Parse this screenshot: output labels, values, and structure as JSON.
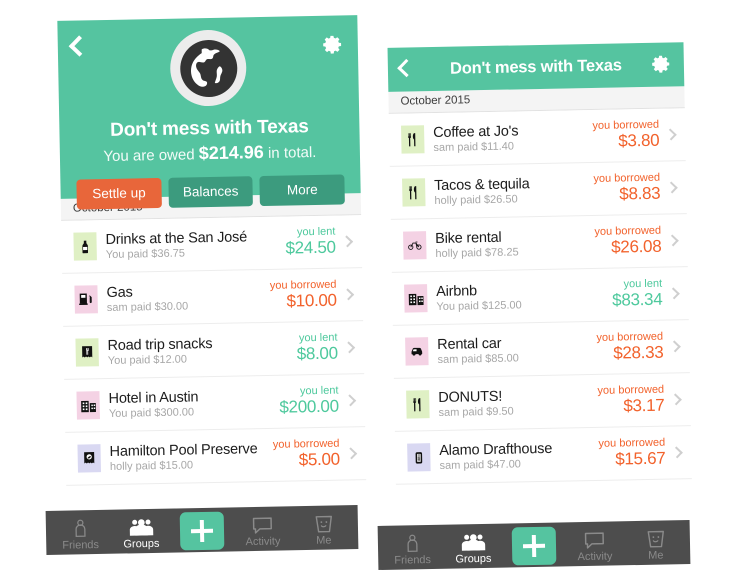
{
  "app": {
    "accent_teal": "#55c4a0",
    "accent_orange": "#e8663a",
    "lent_color": "#4ec99d",
    "borrowed_color": "#f2622c",
    "tabbar_color": "#4d4d4d"
  },
  "left_panel": {
    "back_icon": "back-chevron-icon",
    "settings_icon": "gear-icon",
    "avatar_icon": "globe-avatar",
    "group_title": "Don't mess with Texas",
    "balance_prefix": "You are owed",
    "balance_amount": "$214.96",
    "balance_suffix": "in total.",
    "buttons": [
      {
        "label": "Settle up",
        "style": "primary"
      },
      {
        "label": "Balances",
        "style": "secondary"
      },
      {
        "label": "More",
        "style": "secondary"
      }
    ],
    "month": "October 2015",
    "expenses": [
      {
        "title": "Drinks at the San José",
        "subtitle": "You paid $36.75",
        "label": "you lent",
        "amount": "$24.50",
        "type": "lent",
        "icon": "bottle-icon",
        "icon_bg": "green"
      },
      {
        "title": "Gas",
        "subtitle": "sam paid $30.00",
        "label": "you borrowed",
        "amount": "$10.00",
        "type": "borrowed",
        "icon": "gas-pump-icon",
        "icon_bg": "pink"
      },
      {
        "title": "Road trip snacks",
        "subtitle": "You paid $12.00",
        "label": "you lent",
        "amount": "$8.00",
        "type": "lent",
        "icon": "receipt-icon",
        "icon_bg": "green"
      },
      {
        "title": "Hotel in Austin",
        "subtitle": "You paid $300.00",
        "label": "you lent",
        "amount": "$200.00",
        "type": "lent",
        "icon": "building-icon",
        "icon_bg": "pink"
      },
      {
        "title": "Hamilton Pool Preserve",
        "subtitle": "holly paid $15.00",
        "label": "you borrowed",
        "amount": "$5.00",
        "type": "borrowed",
        "icon": "ticket-icon",
        "icon_bg": "purple"
      }
    ],
    "tabs": [
      {
        "label": "Friends",
        "icon": "person-icon",
        "active": false
      },
      {
        "label": "Groups",
        "icon": "group-icon",
        "active": true
      },
      {
        "label": "Activity",
        "icon": "speech-bubble-icon",
        "active": false
      },
      {
        "label": "Me",
        "icon": "smiley-cup-icon",
        "active": false
      }
    ],
    "add_button": "add-expense-button"
  },
  "right_panel": {
    "back_icon": "back-chevron-icon",
    "settings_icon": "gear-icon",
    "group_title": "Don't mess with Texas",
    "month": "October 2015",
    "expenses": [
      {
        "title": "Coffee at Jo's",
        "subtitle": "sam paid $11.40",
        "label": "you borrowed",
        "amount": "$3.80",
        "type": "borrowed",
        "icon": "cutlery-icon",
        "icon_bg": "green"
      },
      {
        "title": "Tacos & tequila",
        "subtitle": "holly paid $26.50",
        "label": "you borrowed",
        "amount": "$8.83",
        "type": "borrowed",
        "icon": "cutlery-icon",
        "icon_bg": "green"
      },
      {
        "title": "Bike rental",
        "subtitle": "holly paid $78.25",
        "label": "you borrowed",
        "amount": "$26.08",
        "type": "borrowed",
        "icon": "bicycle-icon",
        "icon_bg": "pink"
      },
      {
        "title": "Airbnb",
        "subtitle": "You paid $125.00",
        "label": "you lent",
        "amount": "$83.34",
        "type": "lent",
        "icon": "building-icon",
        "icon_bg": "pink"
      },
      {
        "title": "Rental car",
        "subtitle": "sam paid $85.00",
        "label": "you borrowed",
        "amount": "$28.33",
        "type": "borrowed",
        "icon": "car-icon",
        "icon_bg": "pink"
      },
      {
        "title": "DONUTS!",
        "subtitle": "sam paid $9.50",
        "label": "you borrowed",
        "amount": "$3.17",
        "type": "borrowed",
        "icon": "cutlery-icon",
        "icon_bg": "green"
      },
      {
        "title": "Alamo Drafthouse",
        "subtitle": "sam paid $47.00",
        "label": "you borrowed",
        "amount": "$15.67",
        "type": "borrowed",
        "icon": "film-icon",
        "icon_bg": "purple"
      }
    ],
    "tabs": [
      {
        "label": "Friends",
        "icon": "person-icon",
        "active": false
      },
      {
        "label": "Groups",
        "icon": "group-icon",
        "active": true
      },
      {
        "label": "Activity",
        "icon": "speech-bubble-icon",
        "active": false
      },
      {
        "label": "Me",
        "icon": "smiley-cup-icon",
        "active": false
      }
    ],
    "add_button": "add-expense-button"
  }
}
